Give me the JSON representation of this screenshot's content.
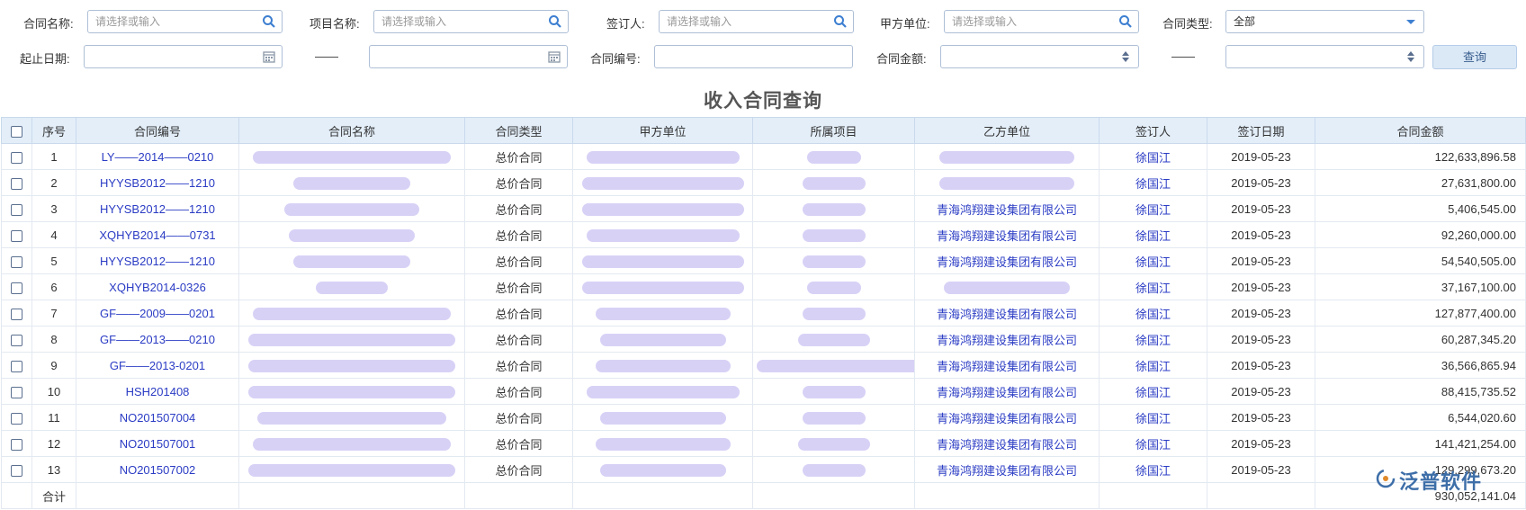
{
  "filters": {
    "contract_name": {
      "label": "合同名称:",
      "placeholder": "请选择或输入"
    },
    "project_name": {
      "label": "项目名称:",
      "placeholder": "请选择或输入"
    },
    "signer": {
      "label": "签订人:",
      "placeholder": "请选择或输入"
    },
    "party_a": {
      "label": "甲方单位:",
      "placeholder": "请选择或输入"
    },
    "contract_type": {
      "label": "合同类型:",
      "value": "全部"
    },
    "date_range": {
      "label": "起止日期:",
      "separator": "——"
    },
    "contract_no": {
      "label": "合同编号:"
    },
    "amount": {
      "label": "合同金额:",
      "separator": "——"
    },
    "query_button": "查询"
  },
  "page_title": "收入合同查询",
  "table": {
    "headers": [
      "序号",
      "合同编号",
      "合同名称",
      "合同类型",
      "甲方单位",
      "所属项目",
      "乙方单位",
      "签订人",
      "签订日期",
      "合同金额"
    ],
    "rows": [
      {
        "seq": "1",
        "no": "LY——2014——0210",
        "type": "总价合同",
        "party_b": "",
        "signer": "徐国江",
        "date": "2019-05-23",
        "amount": "122,633,896.58"
      },
      {
        "seq": "2",
        "no": "HYYSB2012——1210",
        "type": "总价合同",
        "party_b": "",
        "signer": "徐国江",
        "date": "2019-05-23",
        "amount": "27,631,800.00"
      },
      {
        "seq": "3",
        "no": "HYYSB2012——1210",
        "type": "总价合同",
        "party_b": "青海鸿翔建设集团有限公司",
        "signer": "徐国江",
        "date": "2019-05-23",
        "amount": "5,406,545.00"
      },
      {
        "seq": "4",
        "no": "XQHYB2014——0731",
        "type": "总价合同",
        "party_b": "青海鸿翔建设集团有限公司",
        "signer": "徐国江",
        "date": "2019-05-23",
        "amount": "92,260,000.00"
      },
      {
        "seq": "5",
        "no": "HYYSB2012——1210",
        "type": "总价合同",
        "party_b": "青海鸿翔建设集团有限公司",
        "signer": "徐国江",
        "date": "2019-05-23",
        "amount": "54,540,505.00"
      },
      {
        "seq": "6",
        "no": "XQHYB2014-0326",
        "type": "总价合同",
        "party_b": "",
        "signer": "徐国江",
        "date": "2019-05-23",
        "amount": "37,167,100.00"
      },
      {
        "seq": "7",
        "no": "GF——2009——0201",
        "type": "总价合同",
        "party_b": "青海鸿翔建设集团有限公司",
        "signer": "徐国江",
        "date": "2019-05-23",
        "amount": "127,877,400.00"
      },
      {
        "seq": "8",
        "no": "GF——2013——0210",
        "type": "总价合同",
        "party_b": "青海鸿翔建设集团有限公司",
        "signer": "徐国江",
        "date": "2019-05-23",
        "amount": "60,287,345.20"
      },
      {
        "seq": "9",
        "no": "GF——2013-0201",
        "type": "总价合同",
        "party_b": "青海鸿翔建设集团有限公司",
        "signer": "徐国江",
        "date": "2019-05-23",
        "amount": "36,566,865.94"
      },
      {
        "seq": "10",
        "no": "HSH201408",
        "type": "总价合同",
        "party_b": "青海鸿翔建设集团有限公司",
        "signer": "徐国江",
        "date": "2019-05-23",
        "amount": "88,415,735.52"
      },
      {
        "seq": "11",
        "no": "NO201507004",
        "type": "总价合同",
        "party_b": "青海鸿翔建设集团有限公司",
        "signer": "徐国江",
        "date": "2019-05-23",
        "amount": "6,544,020.60"
      },
      {
        "seq": "12",
        "no": "NO201507001",
        "type": "总价合同",
        "party_b": "青海鸿翔建设集团有限公司",
        "signer": "徐国江",
        "date": "2019-05-23",
        "amount": "141,421,254.00"
      },
      {
        "seq": "13",
        "no": "NO201507002",
        "type": "总价合同",
        "party_b": "青海鸿翔建设集团有限公司",
        "signer": "徐国江",
        "date": "2019-05-23",
        "amount": "129,299,673.20"
      }
    ],
    "summary": {
      "label": "合计",
      "total": "930,052,141.04"
    }
  },
  "watermark": "泛普软件",
  "colors": {
    "accent": "#3d7fd1",
    "link": "#2b3cc4",
    "header_bg": "#e3eef9",
    "button_bg": "#dbe8f6"
  }
}
